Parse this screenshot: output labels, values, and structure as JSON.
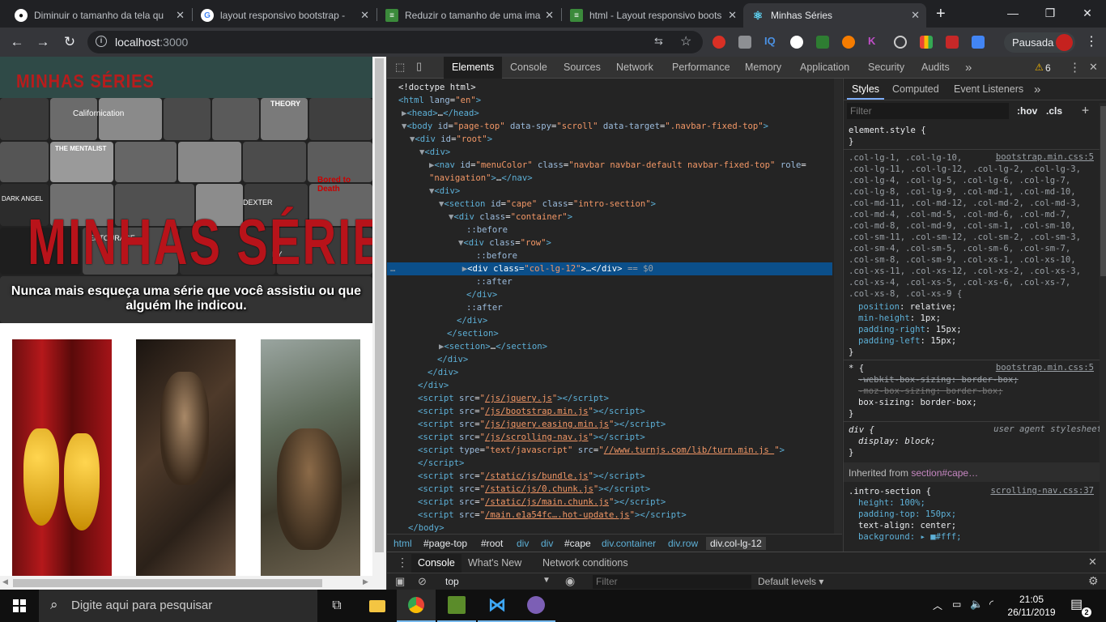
{
  "browser": {
    "tabs": [
      {
        "title": "Diminuir o tamanho da tela qu",
        "icon": "github-icon"
      },
      {
        "title": "layout responsivo bootstrap - ",
        "icon": "google-icon"
      },
      {
        "title": "Reduzir o tamanho de uma ima",
        "icon": "stackoverflow-icon"
      },
      {
        "title": "html - Layout responsivo boots",
        "icon": "stackoverflow-icon"
      },
      {
        "title": "Minhas Séries",
        "icon": "react-icon",
        "active": true
      }
    ],
    "new_tab": "+",
    "address_host": "localhost",
    "address_port": ":3000",
    "profile_label": "Pausada"
  },
  "site": {
    "brand": "MINHAS SÉRIES",
    "hero_title": "MINHAS SÉRIE",
    "hero_tagline": "Nunca mais esqueça uma série que você assistiu ou que alguém lhe indicou.",
    "poster_labels": [
      "Californication",
      "THEORY",
      "THE MENTALIST",
      "DARK ANGEL",
      "Bored to Death",
      "ENTOURAGE",
      "DEXTER",
      "RY"
    ]
  },
  "devtools": {
    "tabs": [
      "Elements",
      "Console",
      "Sources",
      "Network",
      "Performance",
      "Memory",
      "Application",
      "Security",
      "Audits"
    ],
    "more": "»",
    "warnings": "6",
    "breadcrumbs": [
      "html",
      "#page-top",
      "#root",
      "div",
      "div",
      "#cape",
      "div.container",
      "div.row",
      "div.col-lg-12"
    ],
    "styles_tabs": [
      "Styles",
      "Computed",
      "Event Listeners"
    ],
    "filter_placeholder": "Filter",
    "hov": ":hov",
    "cls": ".cls",
    "element_style": "element.style {",
    "rule1_selector": [
      ".col-lg-1, .col-lg-10,",
      ".col-lg-11, .col-lg-12, .col-lg-2, .col-lg-3,",
      ".col-lg-4, .col-lg-5, .col-lg-6, .col-lg-7,",
      ".col-lg-8, .col-lg-9, .col-md-1, .col-md-10,",
      ".col-md-11, .col-md-12, .col-md-2, .col-md-3,",
      ".col-md-4, .col-md-5, .col-md-6, .col-md-7,",
      ".col-md-8, .col-md-9, .col-sm-1, .col-sm-10,",
      ".col-sm-11, .col-sm-12, .col-sm-2, .col-sm-3,",
      ".col-sm-4, .col-sm-5, .col-sm-6, .col-sm-7,",
      ".col-sm-8, .col-sm-9, .col-xs-1, .col-xs-10,",
      ".col-xs-11, .col-xs-12, .col-xs-2, .col-xs-3,",
      ".col-xs-4, .col-xs-5, .col-xs-6, .col-xs-7,",
      ".col-xs-8, .col-xs-9 {"
    ],
    "rule1_source": "bootstrap.min.css:5",
    "rule1_props": [
      {
        "name": "position",
        "value": "relative;"
      },
      {
        "name": "min-height",
        "value": "1px;"
      },
      {
        "name": "padding-right",
        "value": "15px;"
      },
      {
        "name": "padding-left",
        "value": "15px;"
      }
    ],
    "rule2_selector": "* {",
    "rule2_source": "bootstrap.min.css:5",
    "rule2_props": [
      "-webkit-box-sizing: border-box;",
      "-moz-box-sizing: border-box;",
      "box-sizing: border-box;"
    ],
    "rule3_selector": "div {",
    "rule3_source": "user agent stylesheet",
    "rule3_prop": "display: block;",
    "inherited_label": "Inherited from ",
    "inherited_from": "section#cape…",
    "rule4_selector": ".intro-section {",
    "rule4_source": "scrolling-nav.css:37",
    "rule4_props": [
      "height: 100%;",
      "padding-top: 150px;",
      "text-align: center;",
      "background: ▸ ■#fff;"
    ],
    "drawer_tabs": [
      "Console",
      "What's New",
      "Network conditions"
    ],
    "context": "top",
    "console_filter": "Filter",
    "levels": "Default levels ▾"
  },
  "taskbar": {
    "search_placeholder": "Digite aqui para pesquisar",
    "time": "21:05",
    "date": "26/11/2019"
  },
  "colors": {
    "brand_red": "#b81c1c",
    "devtools_accent": "#0b4f8a"
  }
}
